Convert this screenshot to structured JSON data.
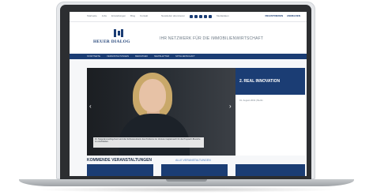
{
  "topbar": {
    "links": [
      "Startseite",
      "Jobs",
      "Einstellungen",
      "Blog",
      "Kontakt"
    ],
    "mid": [
      "Newsletter abonnieren",
      "Mediadaten"
    ],
    "right": [
      "REGISTRIEREN",
      "ANMELDEN"
    ]
  },
  "header": {
    "logo": "HEUER DIALOG",
    "tagline": "IHR NETZWERK FÜR DIE IMMOBILIENWIRTSCHAFT"
  },
  "nav": [
    "STARTSEITE",
    "VERANSTALTUNGEN",
    "MEDIATHEK",
    "NEWSLETTER",
    "MITGLIEDSCHAFT"
  ],
  "hero": {
    "caption": "Dr. Tanja Emmerling-Kunz wird die Schlussrednerin des Podiums zur Venture Capital auch für die Proptech-Branche zu erschließen."
  },
  "panel": {
    "title": "2. REAL INNOVATION",
    "date": "01. August 2019 | Berlin"
  },
  "events": {
    "title": "KOMMENDE VERANSTALTUNGEN",
    "link": "ALLE VERANSTALTUNGEN"
  },
  "colors": {
    "brand": "#1b3d74",
    "accent_link": "#4f7fc0"
  },
  "icons": [
    "facebook-icon",
    "twitter-icon",
    "youtube-icon",
    "xing-icon",
    "linkedin-icon"
  ]
}
